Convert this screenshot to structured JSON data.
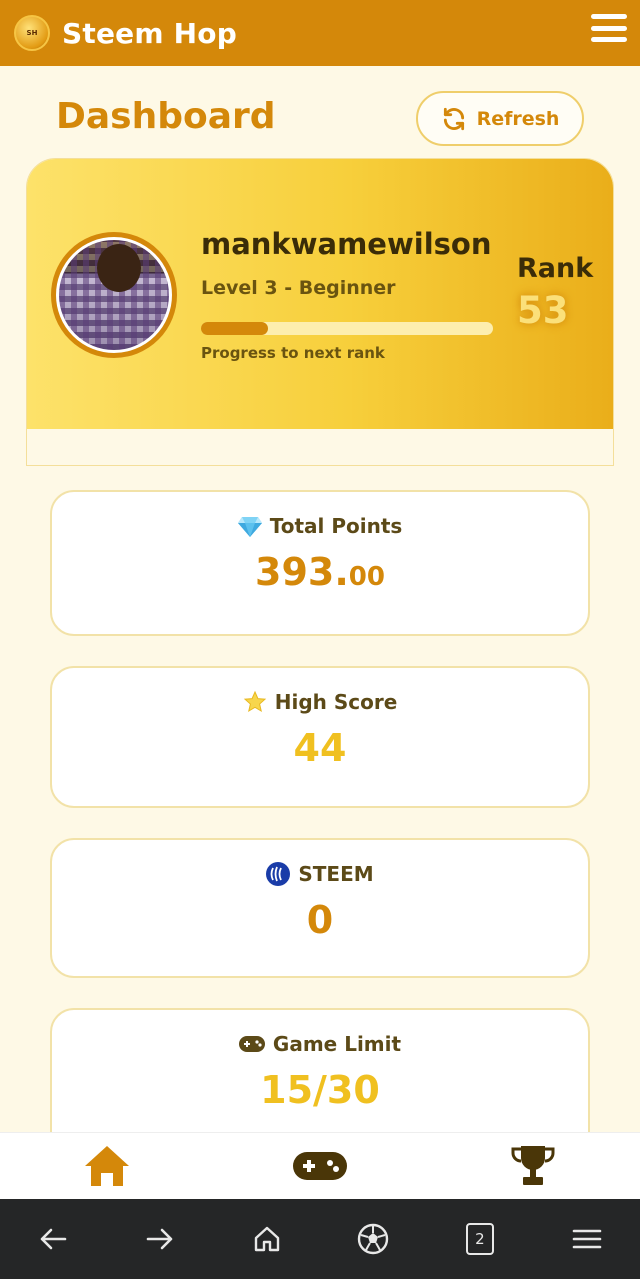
{
  "app": {
    "title": "Steem Hop",
    "logo_text": "STEEM HOP"
  },
  "dashboard": {
    "title": "Dashboard",
    "refresh_label": "Refresh"
  },
  "profile": {
    "username": "mankwamewilson",
    "level": "Level 3 - Beginner",
    "progress_label": "Progress to next rank",
    "progress_fraction": 0.23,
    "rank_label": "Rank",
    "rank_value": "53"
  },
  "stats": [
    {
      "label": "Total Points",
      "icon": "gem-icon",
      "value": "393.",
      "decimal": "00"
    },
    {
      "label": "High Score",
      "icon": "star-icon",
      "value": "44"
    },
    {
      "label": "STEEM",
      "icon": "steem-icon",
      "value": "0"
    },
    {
      "label": "Game Limit",
      "icon": "gamepad-icon",
      "value": "15/30"
    }
  ],
  "bottom_nav": {
    "items": [
      "home-icon",
      "gamepad-icon",
      "trophy-icon"
    ],
    "active": "home-icon"
  },
  "browser": {
    "tab_count": "2"
  },
  "colors": {
    "accent": "#d4880a",
    "gold": "#f0c020",
    "background": "#fef9e6"
  }
}
